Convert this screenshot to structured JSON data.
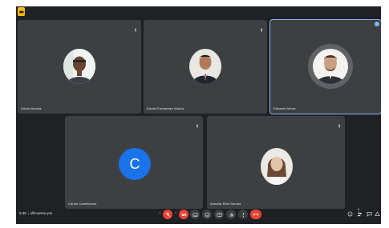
{
  "participants": [
    {
      "name": "Arturo Azuela",
      "kind": "photo"
    },
    {
      "name": "Daniel Fernandez Muñoz",
      "kind": "photo"
    },
    {
      "name": "Eduardo Mena",
      "kind": "photo"
    },
    {
      "name": "Carlos Castellanos",
      "kind": "initial",
      "initial": "C"
    },
    {
      "name": "Alondra Ruiz Santos",
      "kind": "photo"
    }
  ],
  "footer": {
    "time": "9:45",
    "meeting_code": "xfb-wzmx-yvs",
    "people_count": "6"
  },
  "colors": {
    "background": "#202124",
    "tile": "#3c4043",
    "accent": "#8ab4f8",
    "end_call": "#ea4335",
    "avatar_initial_bg": "#1a73e8",
    "brand": "#fbbc04"
  },
  "icons": {
    "left_controls": [
      "mic-off-icon",
      "camera-off-icon"
    ],
    "center_controls": [
      "captions-icon",
      "emoji-icon",
      "present-icon",
      "hand-icon",
      "more-icon",
      "end-call-icon"
    ],
    "right_controls": [
      "info-icon",
      "people-icon",
      "chat-icon",
      "activities-icon",
      "lock-icon"
    ]
  }
}
